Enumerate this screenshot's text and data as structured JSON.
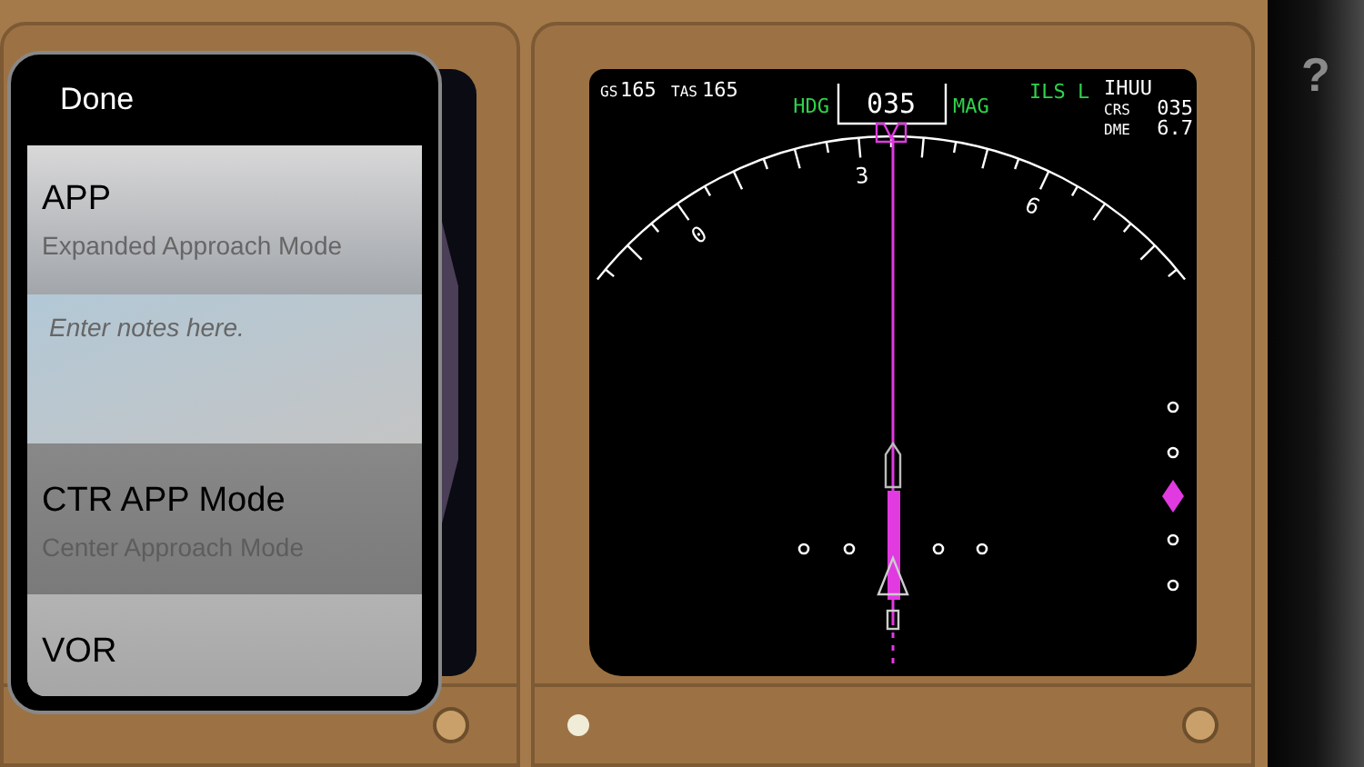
{
  "popup": {
    "done": "Done",
    "items": [
      {
        "title": "APP",
        "subtitle": "Expanded Approach Mode",
        "expanded": true,
        "notes_placeholder": "Enter notes here."
      },
      {
        "title": "CTR APP Mode",
        "subtitle": "Center Approach Mode",
        "expanded": false
      },
      {
        "title": "VOR",
        "expanded": false
      }
    ]
  },
  "display": {
    "gs_label": "GS",
    "gs": "165",
    "tas_label": "TAS",
    "tas": "165",
    "hdg_label": "HDG",
    "heading": "035",
    "mag_label": "MAG",
    "mode": "ILS L",
    "ident": "IHUU",
    "crs_label": "CRS",
    "crs": "035",
    "dme_label": "DME",
    "dme": "6.7",
    "compass_labels": [
      "0",
      "3",
      "6"
    ]
  },
  "help": "?"
}
